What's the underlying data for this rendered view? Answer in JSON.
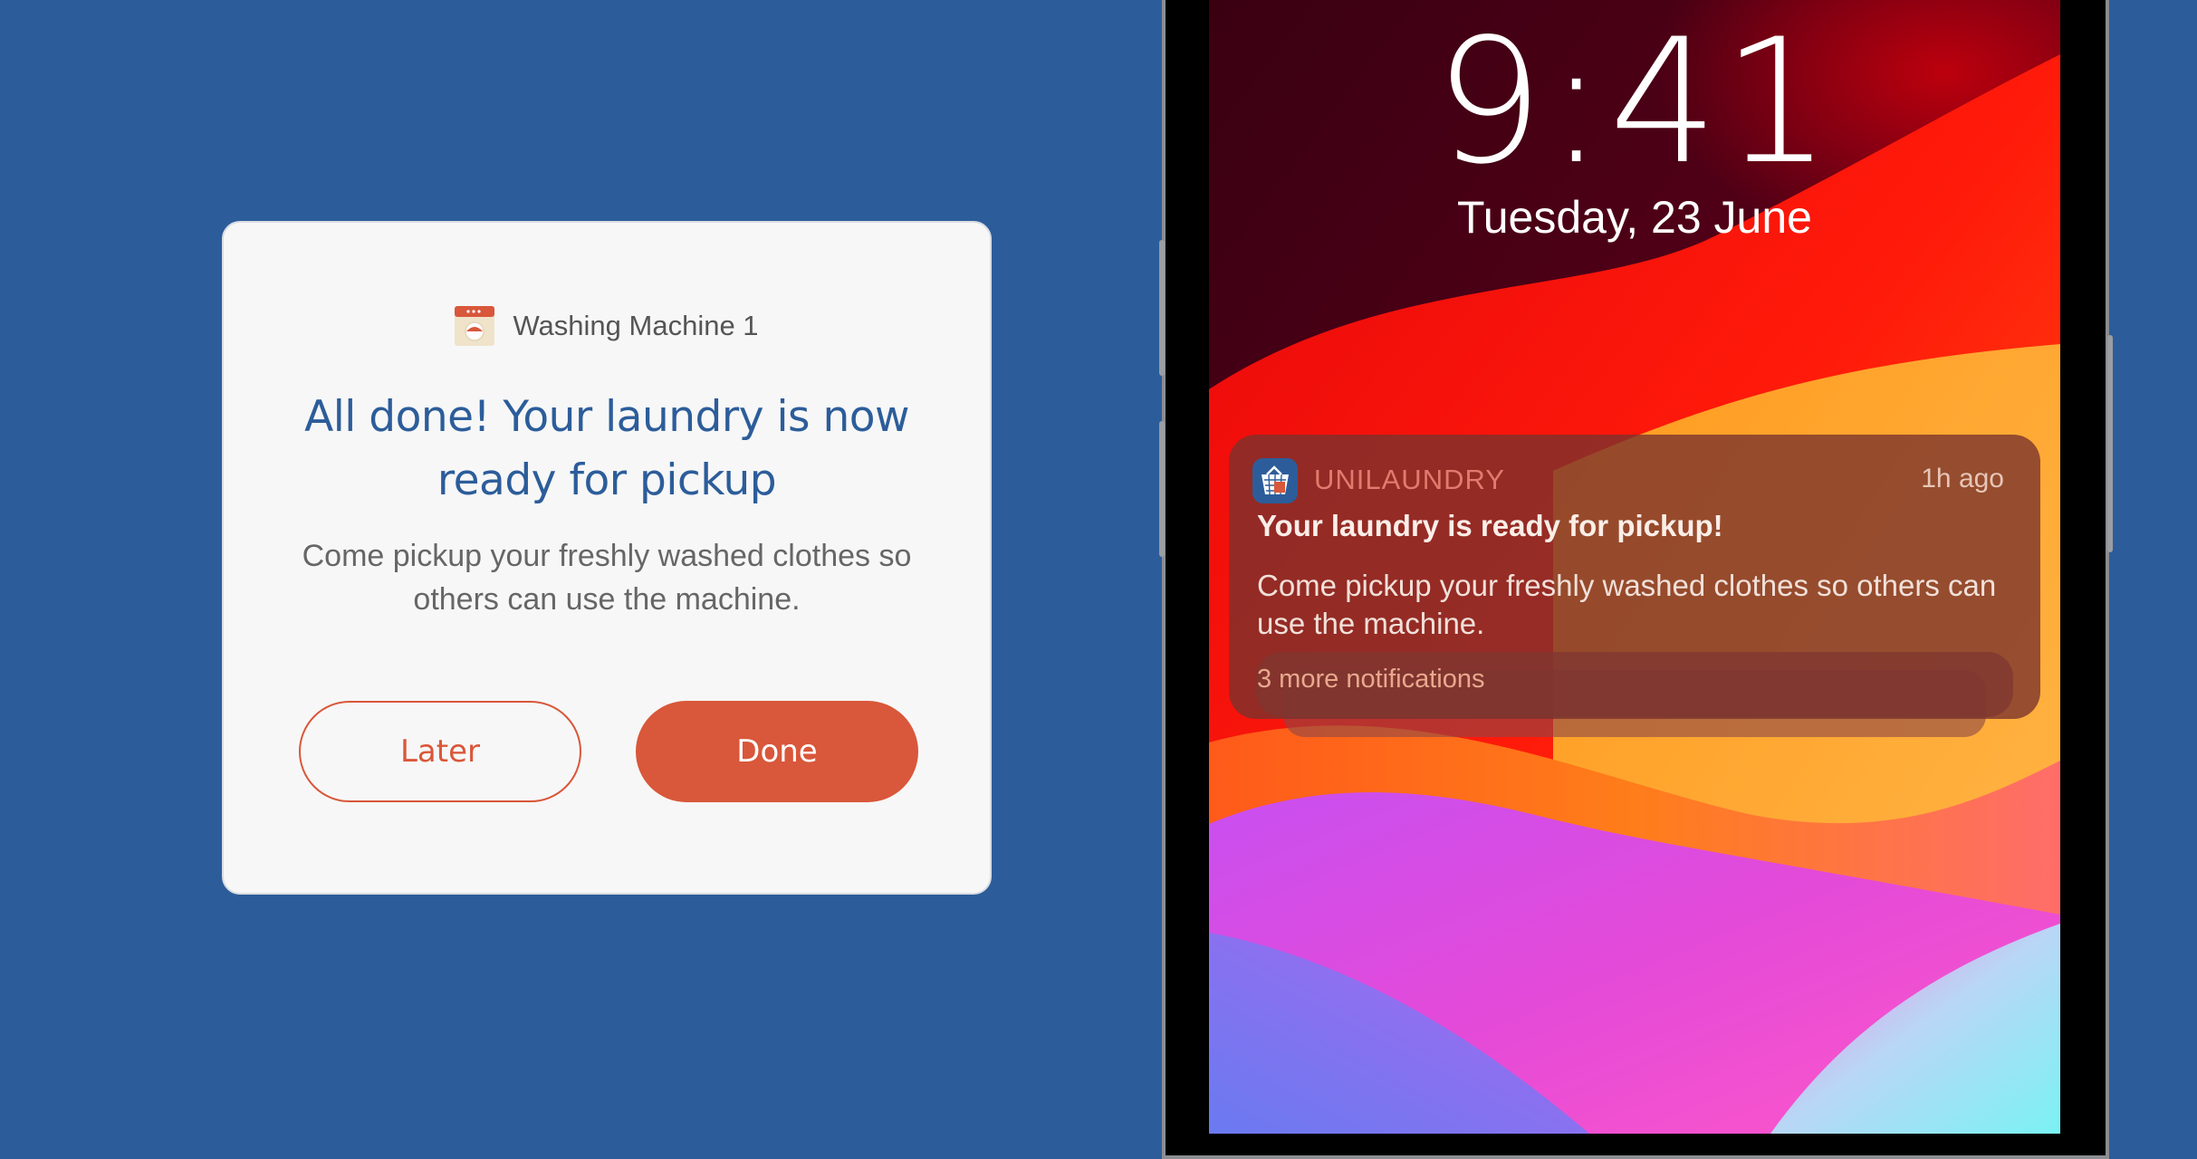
{
  "dialog": {
    "source": "Washing Machine 1",
    "title": "All done! Your laundry is now ready for pickup",
    "body": "Come pickup your freshly washed clothes so others can use the machine.",
    "later_label": "Later",
    "done_label": "Done"
  },
  "lockscreen": {
    "time": "9:41",
    "date": "Tuesday, 23 June"
  },
  "notification": {
    "app_name": "UNILAUNDRY",
    "time_ago": "1h ago",
    "title": "Your laundry is ready for pickup!",
    "body": "Come pickup your freshly washed clothes so others can use the machine.",
    "more": "3 more notifications"
  },
  "colors": {
    "background": "#2c5d9a",
    "accent": "#d9573a",
    "dialog_bg": "#f7f7f7"
  },
  "icons": [
    "washing-machine-icon",
    "unilaundry-app-icon"
  ]
}
